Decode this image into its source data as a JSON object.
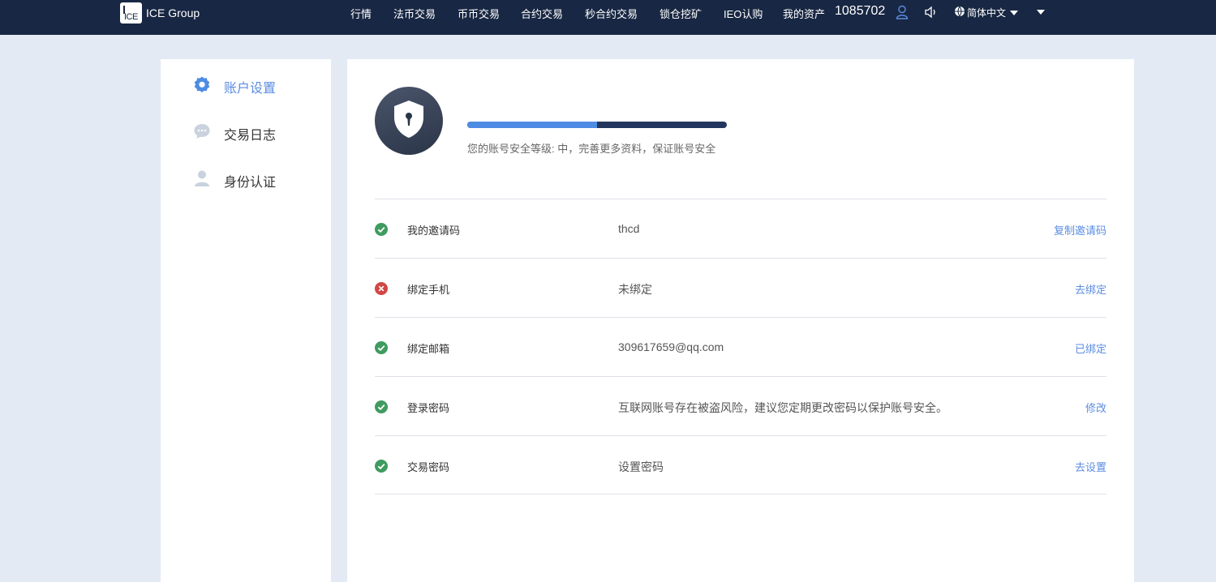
{
  "header": {
    "logo_mark": "ICE",
    "brand": "ICE Group",
    "nav": [
      "行情",
      "法币交易",
      "币币交易",
      "合约交易",
      "秒合约交易",
      "锁仓挖矿",
      "IEO认购",
      "我的资产"
    ],
    "asset_number": "1085702",
    "language": "简体中文",
    "icons": [
      "user-icon",
      "speaker-icon",
      "globe-icon"
    ]
  },
  "sidebar": {
    "items": [
      {
        "label": "账户设置",
        "icon": "gear-icon",
        "active": true
      },
      {
        "label": "交易日志",
        "icon": "chat-bubble-icon",
        "active": false
      },
      {
        "label": "身份认证",
        "icon": "person-icon",
        "active": false
      }
    ]
  },
  "security": {
    "progress_fraction": 0.5,
    "text": "您的账号安全等级: 中，完善更多资料，保证账号安全"
  },
  "rows": [
    {
      "status": "ok",
      "name": "我的邀请码",
      "value": "thcd",
      "action": "复制邀请码"
    },
    {
      "status": "error",
      "name": "绑定手机",
      "value": "未绑定",
      "action": "去绑定"
    },
    {
      "status": "ok",
      "name": "绑定邮箱",
      "value": "309617659@qq.com",
      "action": "已绑定"
    },
    {
      "status": "ok",
      "name": "登录密码",
      "value": "互联网账号存在被盗风险，建议您定期更改密码以保护账号安全。",
      "action": "修改"
    },
    {
      "status": "ok",
      "name": "交易密码",
      "value": "设置密码",
      "action": "去设置"
    }
  ],
  "colors": {
    "nav_bg": "#182743",
    "accent": "#5b8de0",
    "ok": "#3f9b5f",
    "error": "#d24646",
    "page_bg": "#e3eaf4"
  }
}
